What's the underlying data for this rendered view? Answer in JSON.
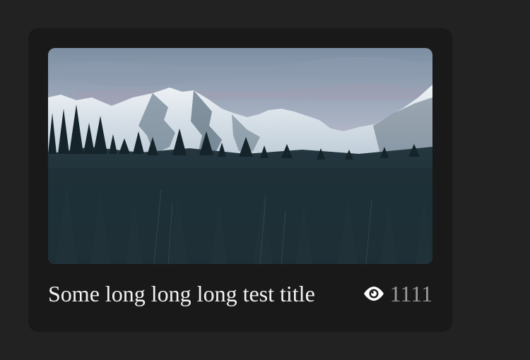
{
  "card": {
    "title": "Some long long long test title",
    "views": "1111",
    "image_alt": "Snowy mountains above a dark pine forest at dusk",
    "view_icon": "eye-icon"
  },
  "colors": {
    "page_bg": "#222222",
    "card_bg": "#191919",
    "title_text": "#f2f2f2",
    "views_text": "#9b9b9b"
  }
}
